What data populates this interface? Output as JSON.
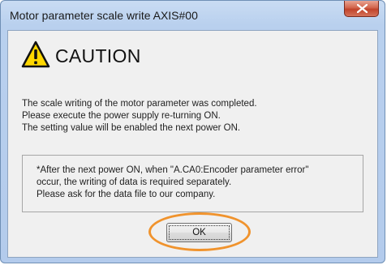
{
  "window": {
    "title": "Motor parameter scale write AXIS#00",
    "close_icon": "close-icon"
  },
  "dialog": {
    "heading": "CAUTION",
    "warning_icon": "warning-icon",
    "messages": [
      "The scale writing of the motor parameter was completed.",
      "Please execute the power supply re-turning ON.",
      "The setting value will be enabled the next power ON."
    ],
    "note_lines": [
      "*After the next power ON, when \"A.CA0:Encoder parameter error\"",
      " occur, the writing of data is required separately.",
      " Please ask for the data file to our company."
    ],
    "ok_label": "OK"
  },
  "colors": {
    "highlight": "#f0932d",
    "warning_fill": "#ffd700"
  }
}
